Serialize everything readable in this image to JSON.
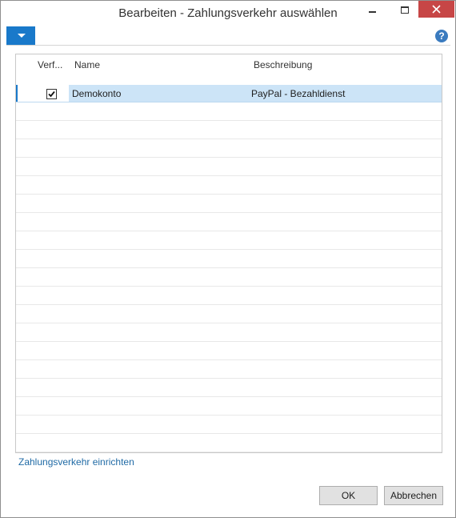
{
  "window": {
    "title": "Bearbeiten - Zahlungsverkehr auswählen",
    "close_color": "#c74646"
  },
  "toolbar": {
    "menu_icon": "chevron-down-icon",
    "help_icon": "question-circle-icon",
    "help_glyph": "?",
    "accent": "#1979ca"
  },
  "table": {
    "columns": [
      "Verf...",
      "Name",
      "Beschreibung"
    ],
    "rows": [
      {
        "available": true,
        "name": "Demokonto",
        "description": "PayPal - Bezahldienst",
        "selected": true
      }
    ],
    "empty_rows": 19
  },
  "footer": {
    "setup_link": "Zahlungsverkehr einrichten",
    "ok_label": "OK",
    "cancel_label": "Abbrechen"
  }
}
